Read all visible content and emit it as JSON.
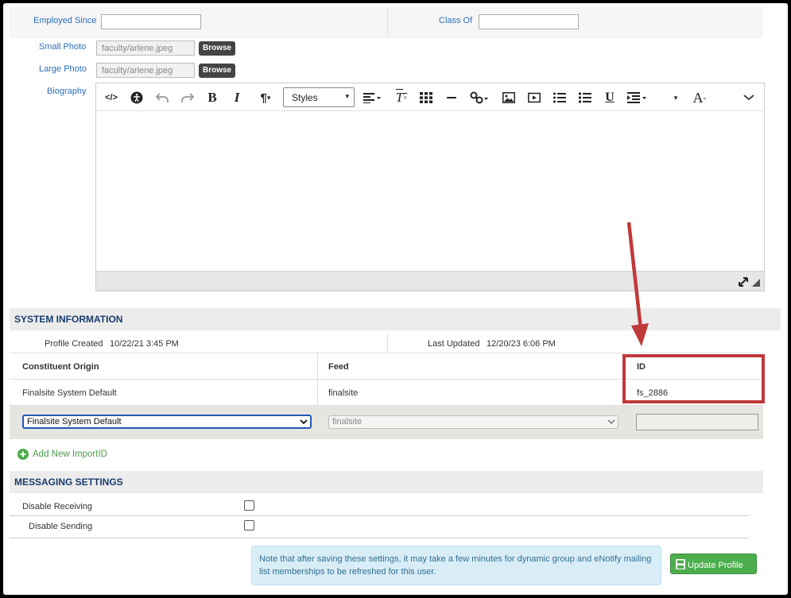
{
  "profile": {
    "employed_since_label": "Employed Since",
    "employed_since_value": "",
    "class_of_label": "Class Of",
    "class_of_value": "",
    "small_photo_label": "Small Photo",
    "small_photo_value": "faculty/arlene.jpeg",
    "large_photo_label": "Large Photo",
    "large_photo_value": "faculty/arlene.jpeg",
    "browse_label": "Browse",
    "biography_label": "Biography"
  },
  "editor": {
    "styles_label": "Styles",
    "icons": [
      "source-code-icon",
      "accessibility-icon",
      "undo-icon",
      "redo-icon",
      "bold-icon",
      "italic-icon",
      "paragraph-icon",
      "align-icon",
      "clear-format-icon",
      "table-icon",
      "horizontal-rule-icon",
      "link-icon",
      "image-icon",
      "video-icon",
      "bullet-list-icon",
      "numbered-list-icon",
      "underline-icon",
      "indent-icon",
      "font-size-icon",
      "more-icon",
      "resize-icon"
    ]
  },
  "system_info": {
    "header": "SYSTEM INFORMATION",
    "profile_created_label": "Profile Created",
    "profile_created_value": "10/22/21 3:45 PM",
    "last_updated_label": "Last Updated",
    "last_updated_value": "12/20/23 6:06 PM",
    "columns": [
      "Constituent Origin",
      "Feed",
      "ID"
    ],
    "row": [
      "Finalsite System Default",
      "finalsite",
      "fs_2886"
    ],
    "origin_select": "Finalsite System Default",
    "feed_select": "finalsite",
    "id_input": "",
    "add_import_label": "Add New ImportID"
  },
  "messaging": {
    "header": "MESSAGING SETTINGS",
    "disable_receiving_label": "Disable Receiving",
    "disable_sending_label": "Disable Sending",
    "note": "Note that after saving these settings, it may take a few minutes for dynamic group and eNotify mailing list memberships to be refreshed for this user.",
    "update_label": "Update Profile"
  },
  "colors": {
    "accent_blue": "#2a6ebb",
    "header_navy": "#1a3d6d",
    "annotation_red": "#c0393b",
    "update_green": "#4cae4c",
    "note_bg": "#d9edf7"
  }
}
